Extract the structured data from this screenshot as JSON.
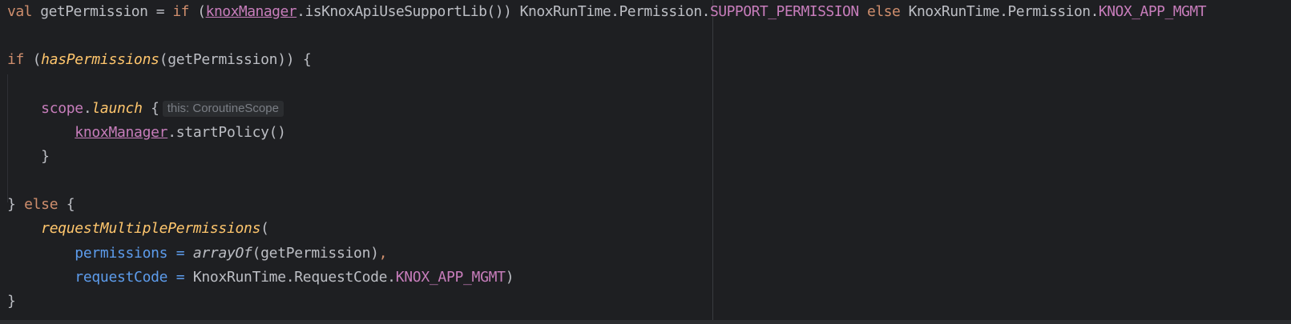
{
  "code": {
    "line1": {
      "kw_val": "val",
      "var_name": " getPermission = ",
      "kw_if": "if",
      "open_paren": " (",
      "knox_manager": "knoxManager",
      "call": ".isKnoxApiUseSupportLib()) KnoxRunTime.Permission.",
      "support_const": "SUPPORT_PERMISSION",
      "space1": " ",
      "kw_else": "else",
      "rest": " KnoxRunTime.Permission.",
      "knox_const": "KNOX_APP_MGMT"
    },
    "line2": {
      "kw_if": "if",
      "open": " (",
      "fn": "hasPermissions",
      "args": "(getPermission)) {"
    },
    "line3": {
      "indent": "    ",
      "scope": "scope",
      "dot": ".",
      "launch": "launch",
      "brace": " {",
      "hint": "this: CoroutineScope"
    },
    "line4": {
      "indent": "        ",
      "knox_manager": "knoxManager",
      "call": ".startPolicy()"
    },
    "line5": {
      "text": "    }"
    },
    "line6": {
      "close": "} ",
      "kw_else": "else",
      "brace": " {"
    },
    "line7": {
      "indent": "    ",
      "fn": "requestMultiplePermissions",
      "paren": "("
    },
    "line8": {
      "indent": "        ",
      "param": "permissions",
      "eq": " = ",
      "fn": "arrayOf",
      "args": "(getPermission)",
      "comma": ","
    },
    "line9": {
      "indent": "        ",
      "param": "requestCode",
      "eq": " = ",
      "path": "KnoxRunTime.RequestCode.",
      "const": "KNOX_APP_MGMT",
      "close": ")"
    },
    "line10": {
      "text": "}"
    }
  },
  "colors": {
    "background": "#1e1f22",
    "keyword": "#cf8e6d",
    "function": "#ffc66d",
    "property": "#c77dbb",
    "parameter": "#5d9cec",
    "text": "#bcbec4"
  }
}
